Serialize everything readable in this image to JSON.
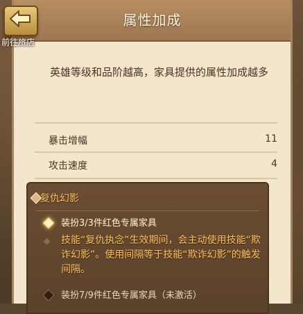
{
  "header": {
    "title": "属性加成",
    "back_label": "前往旅店"
  },
  "description": "英雄等级和品阶越高，家具提供的属性加成越多",
  "stats": [
    {
      "name": "暴击增幅",
      "value": "11"
    },
    {
      "name": "攻击速度",
      "value": "4"
    }
  ],
  "set_bonus": {
    "name": "复仇幻影",
    "tiers": [
      {
        "requirement": "装扮3/3件红色专属家具",
        "effect": "技能“复仇执念”生效期间，会主动使用技能“欺诈幻影”。使用间隔等于技能“欺诈幻影”的触发间隔。",
        "active": true
      },
      {
        "requirement": "装扮7/9件红色专属家具（未激活）",
        "active": false
      }
    ]
  },
  "colors": {
    "accent_gold": "#ffc25c",
    "panel_bg": "#f3e6cd",
    "title_bar": "#a88058",
    "text_dark": "#4a3321"
  },
  "icons": {
    "back": "left-arrow-icon",
    "bullet": "diamond-icon"
  }
}
